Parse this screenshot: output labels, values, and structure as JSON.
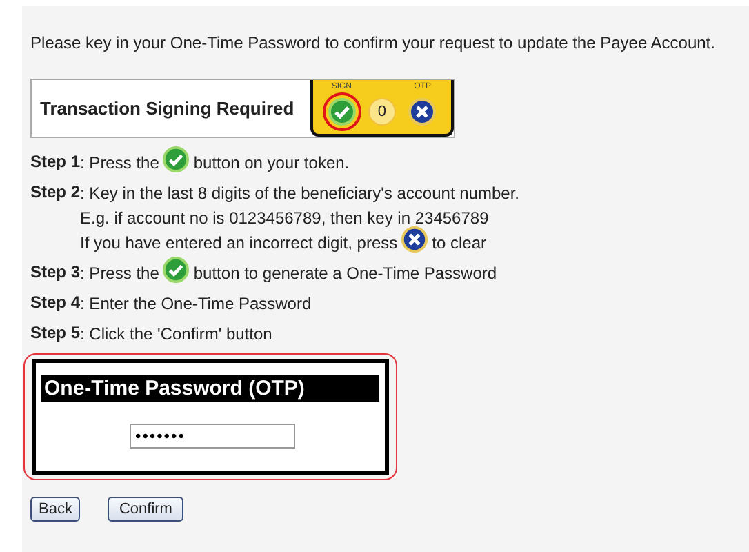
{
  "intro": "Please key in your One-Time Password to confirm your request to update the Payee Account.",
  "banner": {
    "title": "Transaction Signing Required",
    "keys": [
      {
        "kind": "check",
        "label": "SIGN",
        "highlighted": true
      },
      {
        "kind": "digit",
        "label": "0",
        "highlighted": false
      },
      {
        "kind": "clear",
        "label": "OTP",
        "highlighted": false
      }
    ]
  },
  "steps": [
    {
      "label": "Step 1",
      "lines": [
        [
          {
            "kind": "text",
            "text": ": Press the"
          },
          {
            "kind": "check"
          },
          {
            "kind": "text",
            "text": "button on your token."
          }
        ]
      ]
    },
    {
      "label": "Step 2",
      "lines": [
        [
          {
            "kind": "text",
            "text": ": Key in the last 8 digits of the beneficiary's account number."
          }
        ],
        [
          {
            "kind": "text",
            "text": "E.g. if account no is 0123456789, then key in 23456789"
          }
        ],
        [
          {
            "kind": "text",
            "text": "If you have entered an incorrect digit, press"
          },
          {
            "kind": "clear"
          },
          {
            "kind": "text",
            "text": "to clear"
          }
        ]
      ]
    },
    {
      "label": "Step 3",
      "lines": [
        [
          {
            "kind": "text",
            "text": ": Press the"
          },
          {
            "kind": "check"
          },
          {
            "kind": "text",
            "text": "button to generate a One-Time Password"
          }
        ]
      ]
    },
    {
      "label": "Step 4",
      "lines": [
        [
          {
            "kind": "text",
            "text": ": Enter the One-Time Password"
          }
        ]
      ]
    },
    {
      "label": "Step 5",
      "lines": [
        [
          {
            "kind": "text",
            "text": ": Click the 'Confirm' button"
          }
        ]
      ]
    }
  ],
  "otp": {
    "title": "One-Time Password (OTP)",
    "value": "•••••••"
  },
  "buttons": [
    "Back",
    "Confirm"
  ]
}
